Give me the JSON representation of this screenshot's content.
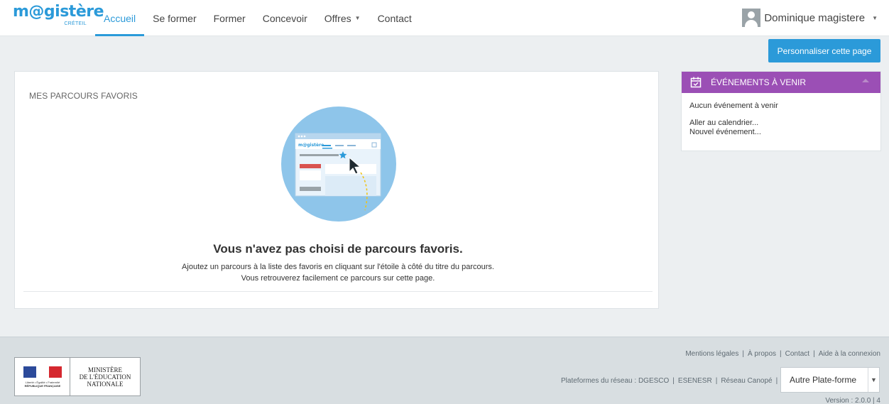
{
  "header": {
    "logo_text": "m@gistère",
    "logo_sub": "CRÉTEIL",
    "nav": [
      {
        "label": "Accueil",
        "active": true
      },
      {
        "label": "Se former"
      },
      {
        "label": "Former"
      },
      {
        "label": "Concevoir"
      },
      {
        "label": "Offres",
        "dropdown": true
      },
      {
        "label": "Contact"
      }
    ],
    "user_name": "Dominique magistere"
  },
  "toolbar": {
    "customize_label": "Personnaliser cette page"
  },
  "favorites": {
    "title": "MES PARCOURS FAVORIS",
    "empty_title": "Vous n'avez pas choisi de parcours favoris.",
    "empty_line1": "Ajoutez un parcours à la liste des favoris en cliquant sur l'étoile à côté du titre du parcours.",
    "empty_line2": "Vous retrouverez facilement ce parcours sur cette page.",
    "illus_logo": "m@gistère"
  },
  "events": {
    "title": "ÉVÉNEMENTS À VENIR",
    "none": "Aucun événement à venir",
    "calendar_link": "Aller au calendrier...",
    "new_link": "Nouvel événement..."
  },
  "footer": {
    "ministry_l1": "MINISTÈRE",
    "ministry_l2": "DE L'ÉDUCATION",
    "ministry_l3": "NATIONALE",
    "republic_l1": "Liberté • Égalité • Fraternité",
    "republic_l2": "RÉPUBLIQUE FRANÇAISE",
    "links": [
      "Mentions légales",
      "À propos",
      "Contact",
      "Aide à la connexion"
    ],
    "platforms_label": "Plateformes du réseau :",
    "platforms": [
      "DGESCO",
      "ESENESR",
      "Réseau Canopé"
    ],
    "platform_select": "Autre Plate-forme",
    "version": "Version : 2.0.0 | 4"
  },
  "colors": {
    "accent": "#2b9ad9",
    "events_header": "#9b4fb5",
    "footer_bg": "#d8dee1",
    "page_bg": "#eceff1"
  }
}
